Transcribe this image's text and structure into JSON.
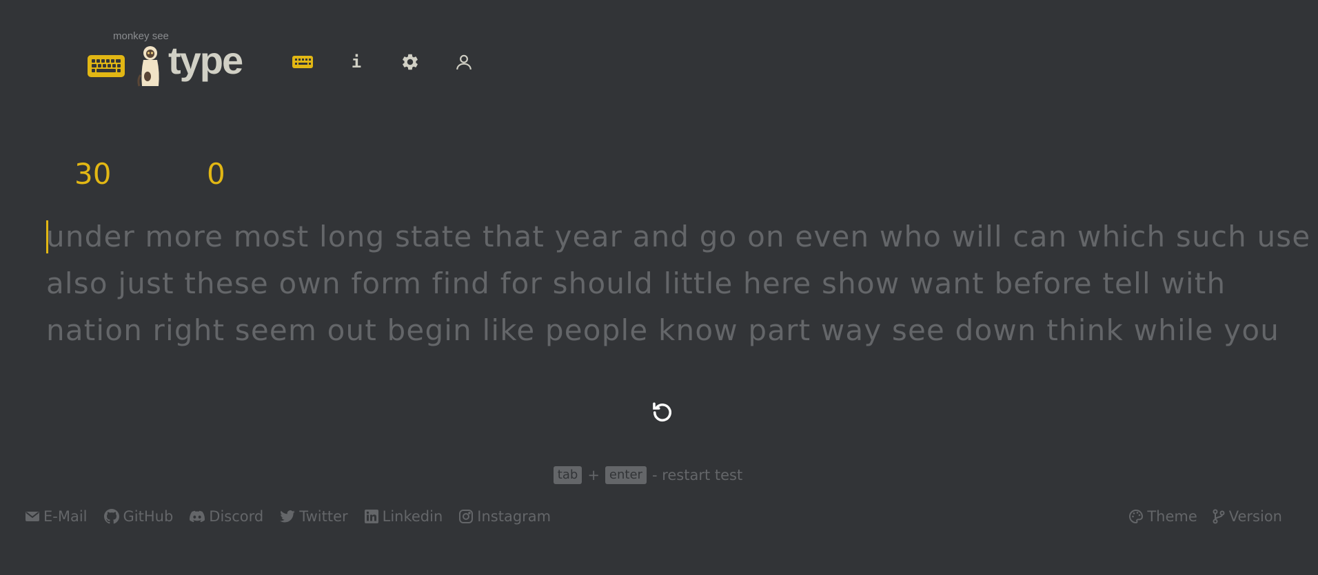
{
  "brand": {
    "subtitle": "monkey see",
    "word": "type"
  },
  "nav": {
    "items": [
      {
        "name": "keyboard",
        "icon": "keyboard-icon"
      },
      {
        "name": "about",
        "icon": "info-icon",
        "glyph": "i"
      },
      {
        "name": "settings",
        "icon": "gear-icon"
      },
      {
        "name": "account",
        "icon": "user-icon"
      }
    ]
  },
  "counters": {
    "timer": "30",
    "wpm": "0"
  },
  "words": {
    "lines": [
      "under more most long state that year and go on even who will can which such use",
      "also just these own form find for should little here show want before tell with",
      "nation right seem out begin like people know part way see down think while you"
    ]
  },
  "hint": {
    "key1": "tab",
    "plus": "+",
    "key2": "enter",
    "text": "- restart test"
  },
  "footer": {
    "left": [
      {
        "label": "E-Mail",
        "icon": "mail-icon"
      },
      {
        "label": "GitHub",
        "icon": "github-icon"
      },
      {
        "label": "Discord",
        "icon": "discord-icon"
      },
      {
        "label": "Twitter",
        "icon": "twitter-icon"
      },
      {
        "label": "Linkedin",
        "icon": "linkedin-icon"
      },
      {
        "label": "Instagram",
        "icon": "instagram-icon"
      }
    ],
    "right": [
      {
        "label": "Theme",
        "icon": "palette-icon"
      },
      {
        "label": "Version",
        "icon": "code-branch-icon"
      }
    ]
  },
  "colors": {
    "background": "#323437",
    "accent": "#e2b714",
    "text": "#d1d0c5",
    "sub": "#646669"
  }
}
